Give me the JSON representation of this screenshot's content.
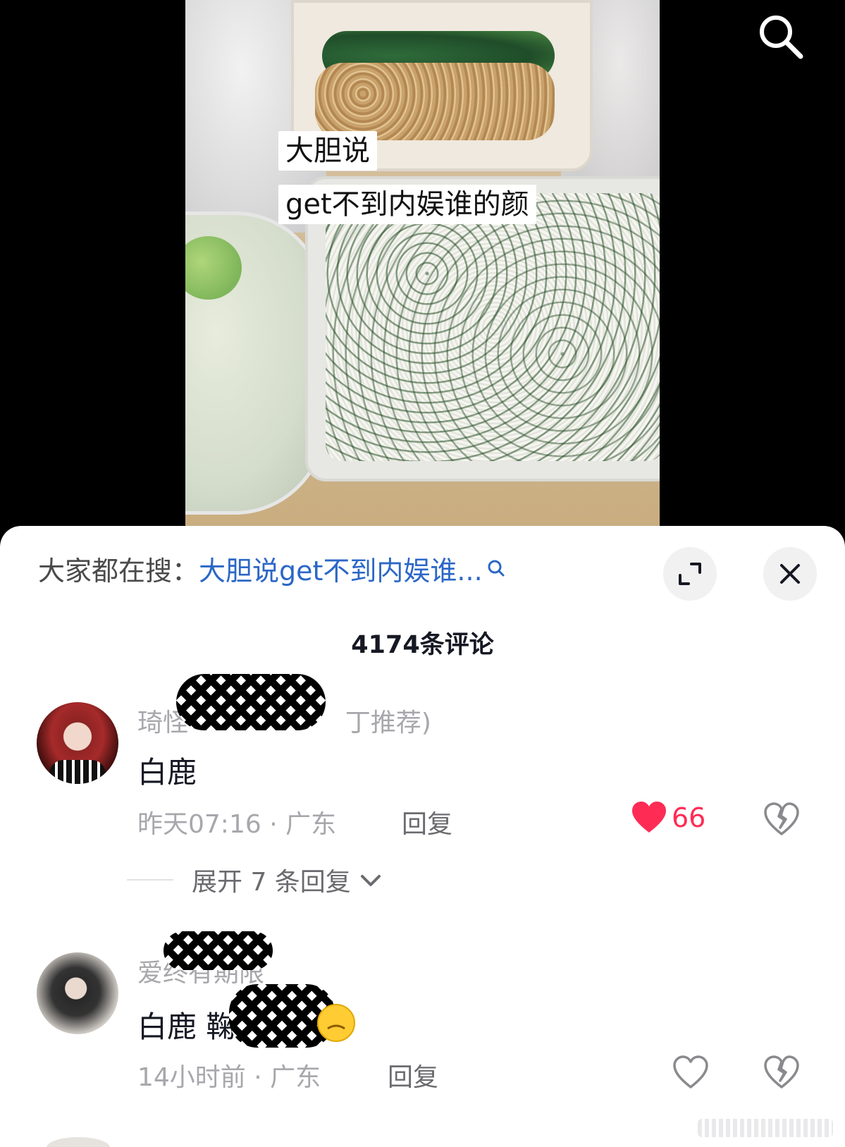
{
  "video": {
    "caption_line1": "大胆说",
    "caption_line2": "get不到内娱谁的颜",
    "search_icon": "search-icon"
  },
  "panel": {
    "hot_search_prefix": "大家都在搜：",
    "hot_search_query": "大胆说get不到内娱谁...",
    "expand_icon": "expand-icon",
    "close_icon": "close-icon",
    "comment_count_title": "4174条评论"
  },
  "comments": [
    {
      "username": "琦怪",
      "username_tail": "丁推荐)",
      "text": "白鹿",
      "time": "昨天07:16",
      "location": "广东",
      "reply_label": "回复",
      "like_count": "66",
      "liked": true,
      "expand_replies_label": "展开 7 条回复"
    },
    {
      "username": "爱终有期限",
      "text": "白鹿 鞠",
      "time": "14小时前",
      "location": "广东",
      "reply_label": "回复",
      "liked": false
    }
  ],
  "colors": {
    "accent_red": "#fe2c55",
    "link_blue": "#2b67c6",
    "muted_text": "#a7a7ac"
  }
}
